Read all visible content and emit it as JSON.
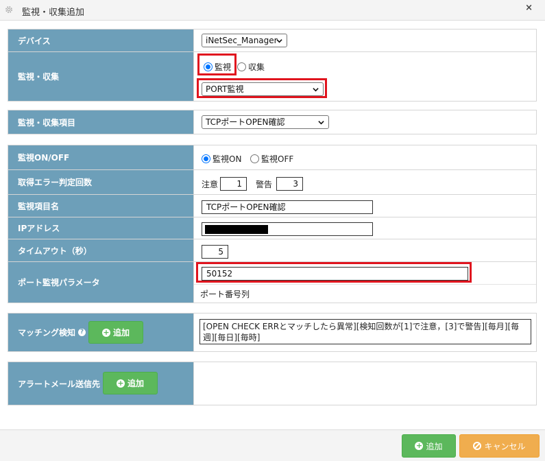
{
  "window": {
    "title": "監視・収集追加",
    "close": "×"
  },
  "device": {
    "label": "デバイス",
    "value": "iNetSec_Manager"
  },
  "monitor_collect": {
    "label": "監視・収集",
    "options": [
      "監視",
      "収集"
    ],
    "selected": "監視",
    "type_value": "PORT監視"
  },
  "item": {
    "label": "監視・収集項目",
    "value": "TCPポートOPEN確認"
  },
  "monitor_onoff": {
    "label": "監視ON/OFF",
    "on_label": "監視ON",
    "off_label": "監視OFF",
    "selected": "on"
  },
  "error_count": {
    "label": "取得エラー判定回数",
    "caution_label": "注意",
    "caution_value": "1",
    "warning_label": "警告",
    "warning_value": "3"
  },
  "item_name": {
    "label": "監視項目名",
    "value": "TCPポートOPEN確認"
  },
  "ip_address": {
    "label": "IPアドレス",
    "value": ""
  },
  "timeout": {
    "label": "タイムアウト（秒）",
    "value": "5"
  },
  "port_param": {
    "label": "ポート監視パラメータ",
    "value": "50152",
    "hint": "ポート番号列"
  },
  "matching": {
    "label": "マッチング検知",
    "add_label": "追加",
    "rule": "[OPEN CHECK ERRとマッチしたら異常][検知回数が[1]で注意，[3]で警告][毎月][毎週][毎日][毎時]"
  },
  "alert_mail": {
    "label": "アラートメール送信先",
    "add_label": "追加"
  },
  "footer": {
    "add_label": "追加",
    "cancel_label": "キャンセル"
  },
  "colors": {
    "label_bg": "#6d9fb9",
    "highlight": "#e0141e",
    "button_green": "#5cb85c",
    "button_orange": "#f0ad4e"
  }
}
